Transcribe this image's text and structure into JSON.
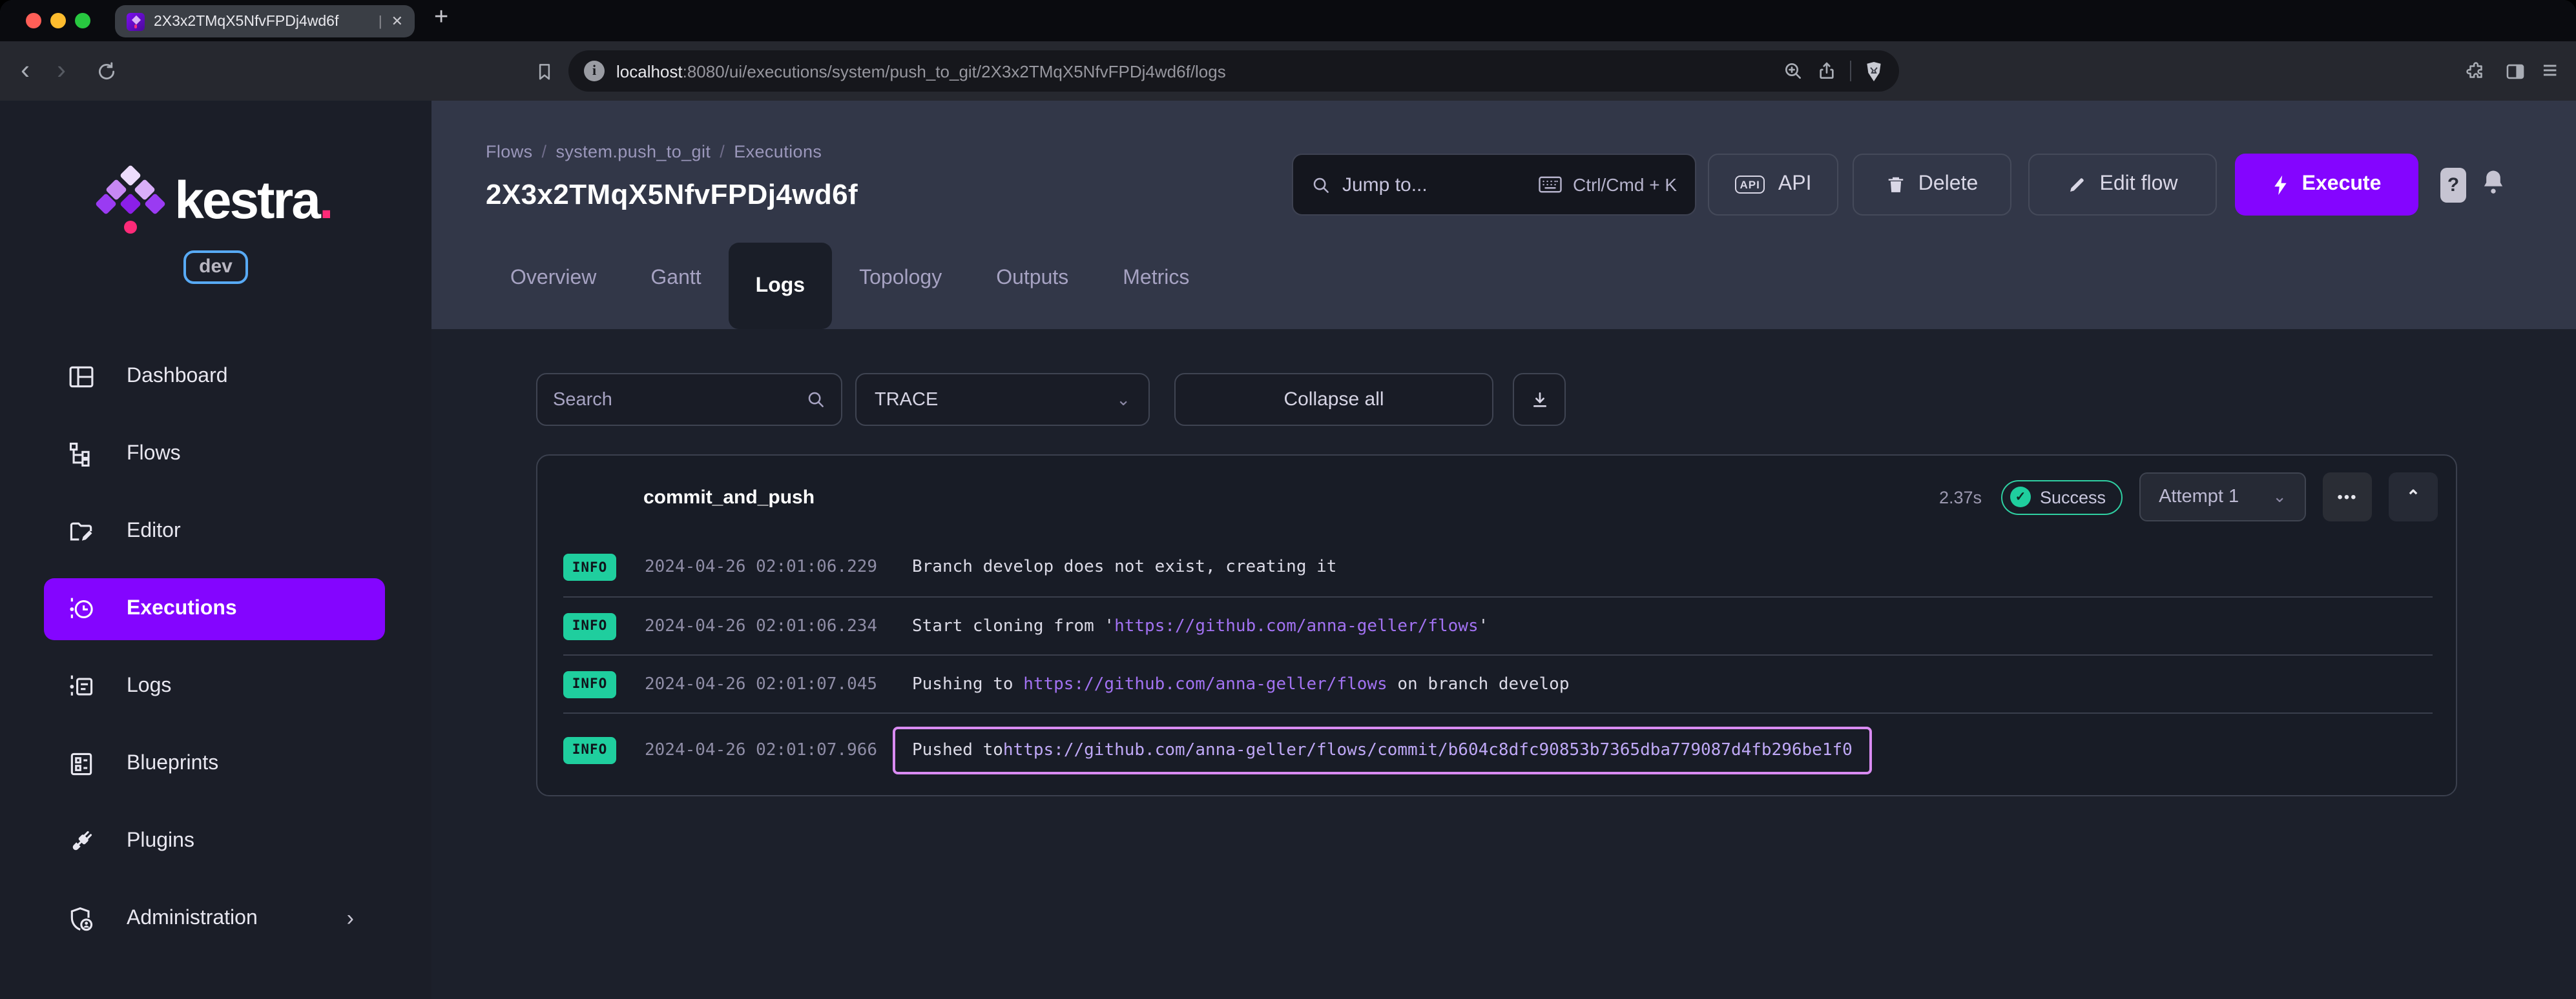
{
  "colors": {
    "purple": "#8405FF",
    "pink": "#FD2A78",
    "teal": "#1FCE9E",
    "link": "#A272F2",
    "highlight": "#D98BF2",
    "devborder": "#58AAF5"
  },
  "browser": {
    "tab": {
      "title": "2X3x2TMqX5NfvFPDj4wd6f",
      "caret": "|",
      "close": "✕",
      "new_tab": "+"
    },
    "nav": {
      "back": "‹",
      "forward": "›"
    },
    "url": {
      "host": "localhost",
      "path": ":8080/ui/executions/system/push_to_git/2X3x2TMqX5NfvFPDj4wd6f/logs",
      "info": "i"
    },
    "more_menu": "≡"
  },
  "sidebar": {
    "logo_text": "kestra",
    "logo_dot": ".",
    "env_badge": "dev",
    "items": [
      {
        "label": "Dashboard"
      },
      {
        "label": "Flows"
      },
      {
        "label": "Editor"
      },
      {
        "label": "Executions",
        "active": true
      },
      {
        "label": "Logs"
      },
      {
        "label": "Blueprints"
      },
      {
        "label": "Plugins"
      },
      {
        "label": "Administration",
        "chevron": "›"
      }
    ]
  },
  "header": {
    "breadcrumb": [
      "Flows",
      "system.push_to_git",
      "Executions"
    ],
    "separator": "/",
    "title": "2X3x2TMqX5NfvFPDj4wd6f",
    "jump_to": {
      "placeholder": "Jump to...",
      "shortcut": "Ctrl/Cmd + K"
    },
    "buttons": {
      "api": "API",
      "api_chip": "API",
      "delete": "Delete",
      "edit_flow": "Edit flow",
      "execute": "Execute",
      "help": "?"
    },
    "tabs": [
      {
        "label": "Overview"
      },
      {
        "label": "Gantt"
      },
      {
        "label": "Logs",
        "active": true
      },
      {
        "label": "Topology"
      },
      {
        "label": "Outputs"
      },
      {
        "label": "Metrics"
      }
    ]
  },
  "filters": {
    "search_placeholder": "Search",
    "level": "TRACE",
    "collapse_all": "Collapse all",
    "chevron": "⌄"
  },
  "panel": {
    "task_name": "commit_and_push",
    "duration": "2.37s",
    "status": "Success",
    "status_check": "✓",
    "attempt": "Attempt 1",
    "attempt_chevron": "⌄",
    "more": "•••",
    "collapse_chevron": "⌃",
    "logs": [
      {
        "level": "INFO",
        "ts": "2024-04-26 02:01:06.229",
        "parts": [
          {
            "t": "Branch develop does not exist, creating it"
          }
        ]
      },
      {
        "level": "INFO",
        "ts": "2024-04-26 02:01:06.234",
        "parts": [
          {
            "t": "Start cloning from '"
          },
          {
            "t": "https://github.com/anna-geller/flows",
            "link": true
          },
          {
            "t": "'"
          }
        ]
      },
      {
        "level": "INFO",
        "ts": "2024-04-26 02:01:07.045",
        "parts": [
          {
            "t": "Pushing to "
          },
          {
            "t": "https://github.com/anna-geller/flows",
            "link": true
          },
          {
            "t": " on branch develop"
          }
        ]
      },
      {
        "level": "INFO",
        "ts": "2024-04-26 02:01:07.966",
        "highlight": true,
        "parts": [
          {
            "t": "Pushed to "
          },
          {
            "t": "https://github.com/anna-geller/flows/commit/b604c8dfc90853b7365dba779087d4fb296be1f0",
            "link": true
          }
        ]
      }
    ]
  }
}
